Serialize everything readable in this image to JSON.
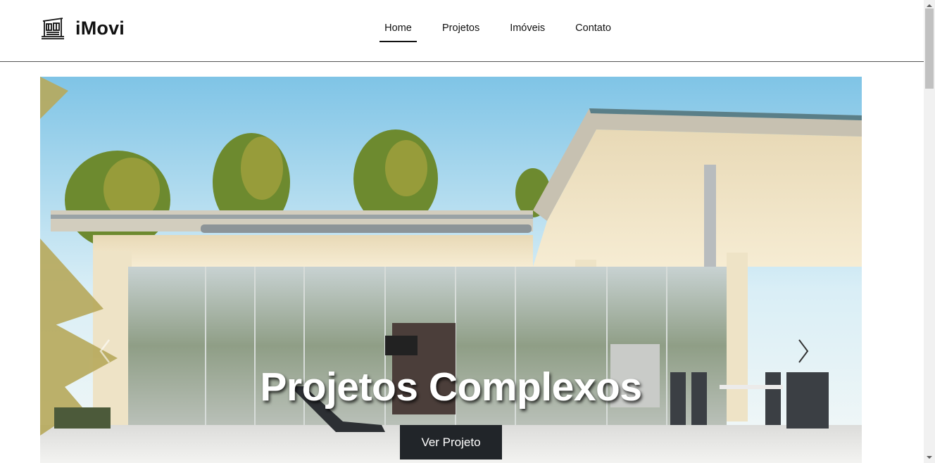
{
  "brand": {
    "name": "iMovi",
    "logo_icon": "building-icon"
  },
  "nav": {
    "items": [
      {
        "label": "Home",
        "active": true
      },
      {
        "label": "Projetos",
        "active": false
      },
      {
        "label": "Imóveis",
        "active": false
      },
      {
        "label": "Contato",
        "active": false
      }
    ]
  },
  "hero": {
    "title": "Projetos Complexos",
    "button_label": "Ver Projeto",
    "prev_icon": "chevron-left-icon",
    "next_icon": "chevron-right-icon"
  },
  "colors": {
    "button_bg": "#212529",
    "text": "#111111",
    "header_border": "#555555"
  }
}
